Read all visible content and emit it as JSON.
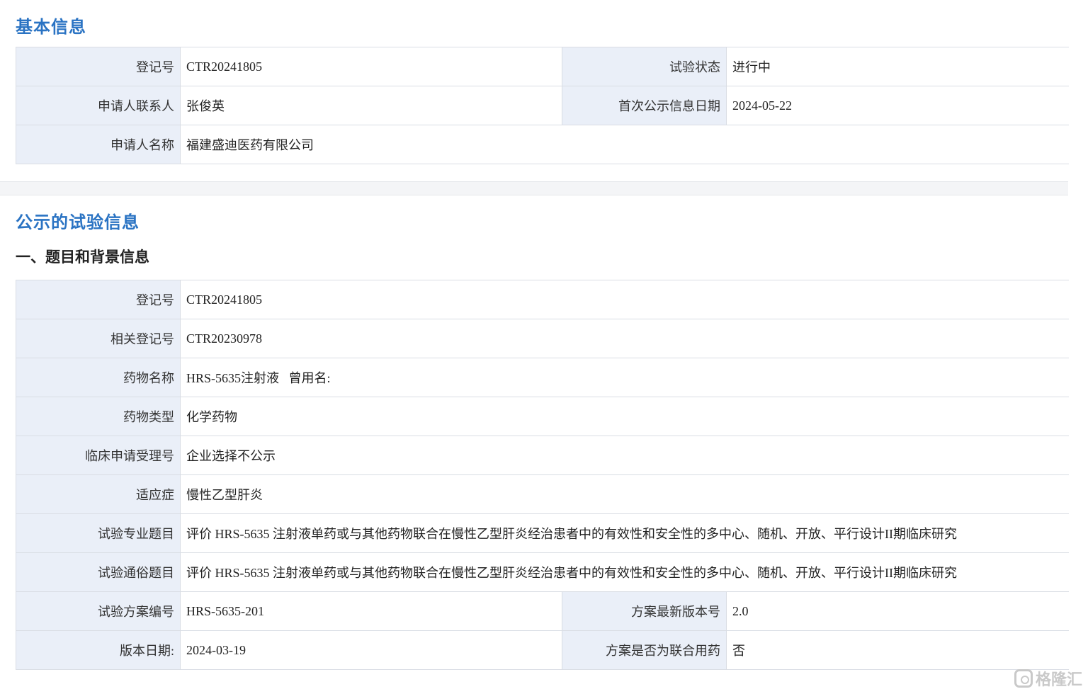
{
  "basic_info": {
    "title": "基本信息",
    "reg_no_label": "登记号",
    "reg_no": "CTR20241805",
    "status_label": "试验状态",
    "status": "进行中",
    "contact_label": "申请人联系人",
    "contact": "张俊英",
    "first_public_date_label": "首次公示信息日期",
    "first_public_date": "2024-05-22",
    "applicant_label": "申请人名称",
    "applicant": "福建盛迪医药有限公司"
  },
  "public_trial_info": {
    "title": "公示的试验信息",
    "subsection_title": "一、题目和背景信息",
    "reg_no_label": "登记号",
    "reg_no": "CTR20241805",
    "related_reg_no_label": "相关登记号",
    "related_reg_no": "CTR20230978",
    "drug_name_label": "药物名称",
    "drug_name": "HRS-5635注射液   曾用名:",
    "drug_type_label": "药物类型",
    "drug_type": "化学药物",
    "clinical_acceptance_no_label": "临床申请受理号",
    "clinical_acceptance_no": "企业选择不公示",
    "indication_label": "适应症",
    "indication": "慢性乙型肝炎",
    "professional_title_label": "试验专业题目",
    "professional_title": "评价 HRS-5635 注射液单药或与其他药物联合在慢性乙型肝炎经治患者中的有效性和安全性的多中心、随机、开放、平行设计II期临床研究",
    "popular_title_label": "试验通俗题目",
    "popular_title": "评价 HRS-5635 注射液单药或与其他药物联合在慢性乙型肝炎经治患者中的有效性和安全性的多中心、随机、开放、平行设计II期临床研究",
    "protocol_no_label": "试验方案编号",
    "protocol_no": "HRS-5635-201",
    "latest_version_label": "方案最新版本号",
    "latest_version": "2.0",
    "version_date_label": "版本日期:",
    "version_date": "2024-03-19",
    "combo_label": "方案是否为联合用药",
    "combo": "否"
  },
  "watermark": {
    "text": "格隆汇"
  }
}
